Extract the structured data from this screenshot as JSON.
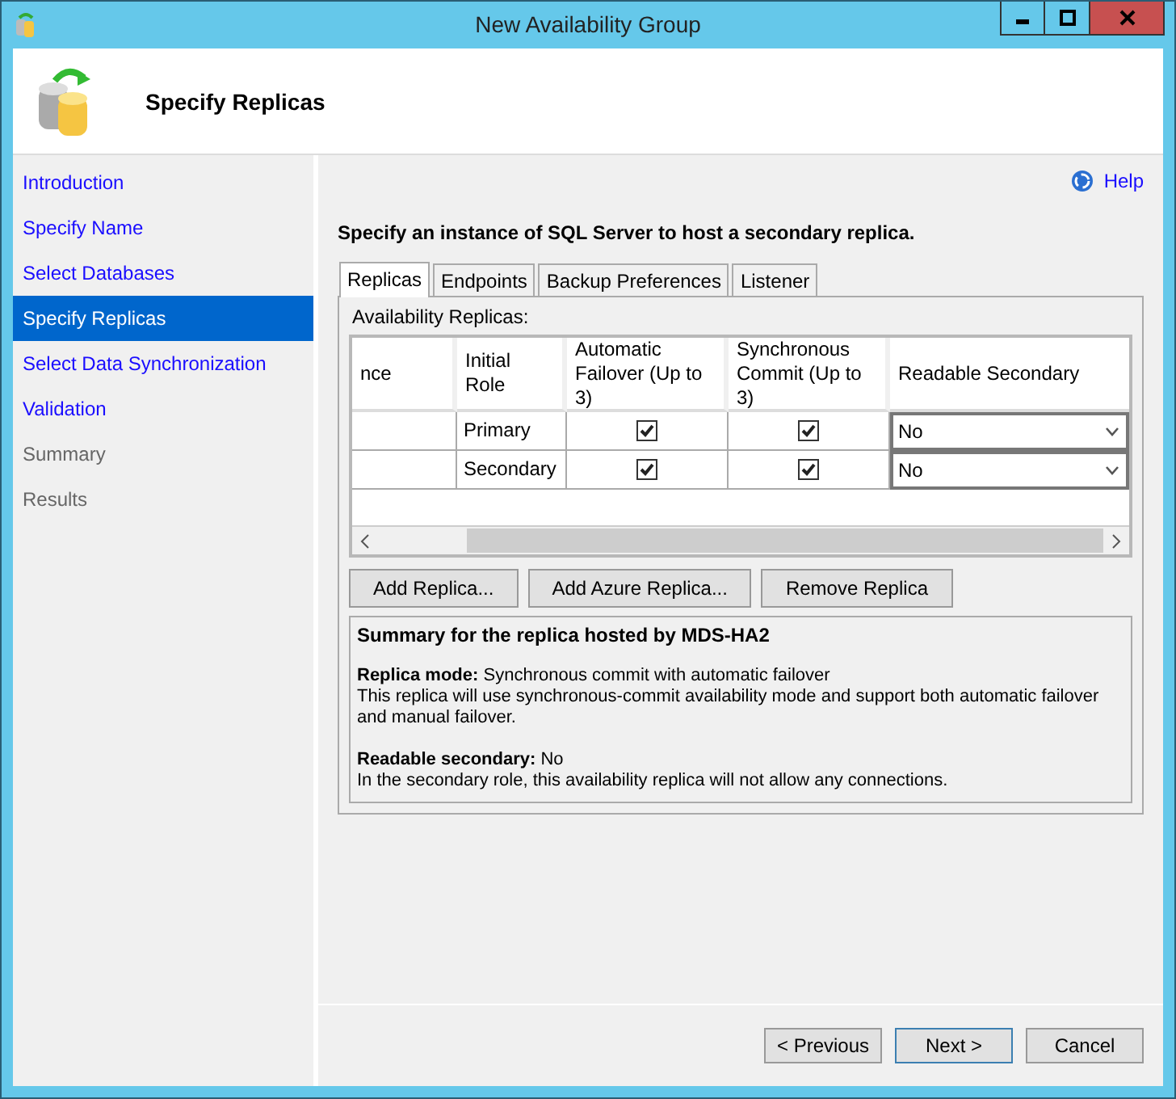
{
  "window": {
    "title": "New Availability Group"
  },
  "header": {
    "title": "Specify Replicas"
  },
  "sidebar": {
    "items": [
      {
        "label": "Introduction",
        "selected": false,
        "enabled": true
      },
      {
        "label": "Specify Name",
        "selected": false,
        "enabled": true
      },
      {
        "label": "Select Databases",
        "selected": false,
        "enabled": true
      },
      {
        "label": "Specify Replicas",
        "selected": true,
        "enabled": true
      },
      {
        "label": "Select Data Synchronization",
        "selected": false,
        "enabled": true
      },
      {
        "label": "Validation",
        "selected": false,
        "enabled": true
      },
      {
        "label": "Summary",
        "selected": false,
        "enabled": false
      },
      {
        "label": "Results",
        "selected": false,
        "enabled": false
      }
    ]
  },
  "help": "Help",
  "instruction": "Specify an instance of SQL Server to host a secondary replica.",
  "tabs": [
    {
      "label": "Replicas",
      "selected": true
    },
    {
      "label": "Endpoints",
      "selected": false
    },
    {
      "label": "Backup Preferences",
      "selected": false
    },
    {
      "label": "Listener",
      "selected": false
    }
  ],
  "group_label": "Availability Replicas:",
  "table": {
    "columns": [
      "nce",
      "Initial Role",
      "Automatic Failover (Up to 3)",
      "Synchronous Commit (Up to 3)",
      "Readable Secondary"
    ],
    "rows": [
      {
        "role": "Primary",
        "automatic_failover": true,
        "synchronous_commit": true,
        "readable_secondary": "No"
      },
      {
        "role": "Secondary",
        "automatic_failover": true,
        "synchronous_commit": true,
        "readable_secondary": "No"
      }
    ]
  },
  "buttons": [
    "Add Replica...",
    "Add Azure Replica...",
    "Remove Replica"
  ],
  "summary": {
    "title": "Summary for the replica hosted by MDS-HA2",
    "lines": [
      "**Replica mode:** Synchronous commit with automatic failover",
      "This replica will use synchronous-commit availability mode and support both automatic failover and manual failover.",
      "**Readable secondary:** No",
      "In the secondary role, this availability replica will not allow any connections."
    ]
  },
  "footer_buttons": [
    "< Previous",
    "Next >",
    "Cancel"
  ]
}
